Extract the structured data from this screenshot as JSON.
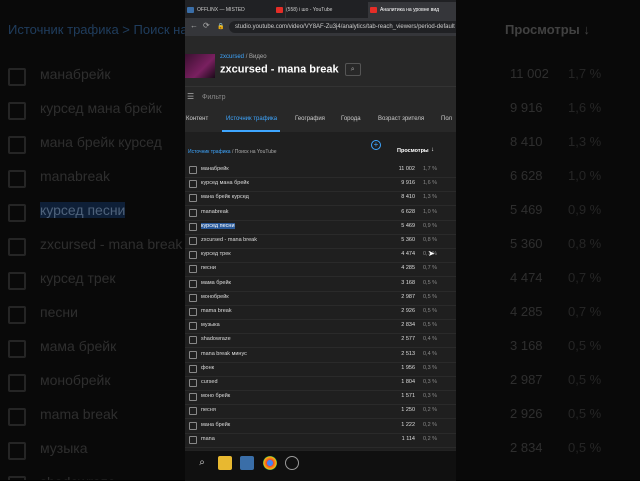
{
  "background": {
    "header_left": "Источник трафика > Поиск на",
    "header_right": "Просмотры ↓",
    "rows": [
      {
        "text": "манабрейк",
        "value": "11 002",
        "pct": "1,7 %"
      },
      {
        "text": "курсед мана брейк",
        "value": "9 916",
        "pct": "1,6 %"
      },
      {
        "text": "мана брейк курсед",
        "value": "8 410",
        "pct": "1,3 %"
      },
      {
        "text": "manabreak",
        "value": "6 628",
        "pct": "1,0 %"
      },
      {
        "text": "курсед песни",
        "value": "5 469",
        "pct": "0,9 %",
        "highlight": true
      },
      {
        "text": "zxcursed - mana break",
        "value": "5 360",
        "pct": "0,8 %"
      },
      {
        "text": "курсед трек",
        "value": "4 474",
        "pct": "0,7 %"
      },
      {
        "text": "песни",
        "value": "4 285",
        "pct": "0,7 %"
      },
      {
        "text": "мама брейк",
        "value": "3 168",
        "pct": "0,5 %"
      },
      {
        "text": "монобрейк",
        "value": "2 987",
        "pct": "0,5 %"
      },
      {
        "text": "mama break",
        "value": "2 926",
        "pct": "0,5 %"
      },
      {
        "text": "музыка",
        "value": "2 834",
        "pct": "0,5 %"
      },
      {
        "text": "shadowraze",
        "value": "",
        "pct": ""
      }
    ]
  },
  "browser": {
    "tabs": [
      {
        "label": "OFFLINX — MISTED",
        "color": "#3a6ea8"
      },
      {
        "label": "(558) i шо - YouTube",
        "color": "#e52d27"
      },
      {
        "label": "Аналитика на уровне вид",
        "color": "#e52d27",
        "active": true
      }
    ],
    "url": "studio.youtube.com/video/VY8AF-Zu3j4/analytics/tab-reach_viewers/period-default"
  },
  "video": {
    "channel": "zxcursed",
    "crumb_sep": "/",
    "crumb_label": "Видео",
    "title": "zxcursed - mana break"
  },
  "filter_label": "Фильтр",
  "subtabs": [
    "Контент",
    "Источник трафика",
    "География",
    "Города",
    "Возраст зрителя",
    "Пол"
  ],
  "table": {
    "crumb_link": "Источник трафика",
    "crumb_rest": " / Поиск на YouTube",
    "views_header": "Просмотры",
    "rows": [
      {
        "text": "манабрейк",
        "value": "11 002",
        "pct": "1,7 %"
      },
      {
        "text": "курсед мана брейк",
        "value": "9 916",
        "pct": "1,6 %"
      },
      {
        "text": "мана брейк курсед",
        "value": "8 410",
        "pct": "1,3 %"
      },
      {
        "text": "manabreak",
        "value": "6 628",
        "pct": "1,0 %"
      },
      {
        "text": "курсед песни",
        "value": "5 469",
        "pct": "0,9 %",
        "highlight": true
      },
      {
        "text": "zxcursed - mana break",
        "value": "5 360",
        "pct": "0,8 %"
      },
      {
        "text": "курсед трек",
        "value": "4 474",
        "pct": "0,7 %"
      },
      {
        "text": "песни",
        "value": "4 285",
        "pct": "0,7 %"
      },
      {
        "text": "мама брейк",
        "value": "3 168",
        "pct": "0,5 %"
      },
      {
        "text": "монобрейк",
        "value": "2 987",
        "pct": "0,5 %"
      },
      {
        "text": "mama break",
        "value": "2 926",
        "pct": "0,5 %"
      },
      {
        "text": "музыка",
        "value": "2 834",
        "pct": "0,5 %"
      },
      {
        "text": "shadowraze",
        "value": "2 577",
        "pct": "0,4 %"
      },
      {
        "text": "mana break минус",
        "value": "2 513",
        "pct": "0,4 %"
      },
      {
        "text": "фонк",
        "value": "1 956",
        "pct": "0,3 %"
      },
      {
        "text": "cursed",
        "value": "1 804",
        "pct": "0,3 %"
      },
      {
        "text": "моно брейк",
        "value": "1 571",
        "pct": "0,3 %"
      },
      {
        "text": "песня",
        "value": "1 250",
        "pct": "0,2 %"
      },
      {
        "text": "мана брейк",
        "value": "1 222",
        "pct": "0,2 %"
      },
      {
        "text": "mana",
        "value": "1 114",
        "pct": "0,2 %"
      }
    ]
  },
  "taskbar_icons": [
    "search-icon",
    "file-explorer-icon",
    "photo-editor-icon",
    "chrome-icon",
    "obs-icon"
  ]
}
